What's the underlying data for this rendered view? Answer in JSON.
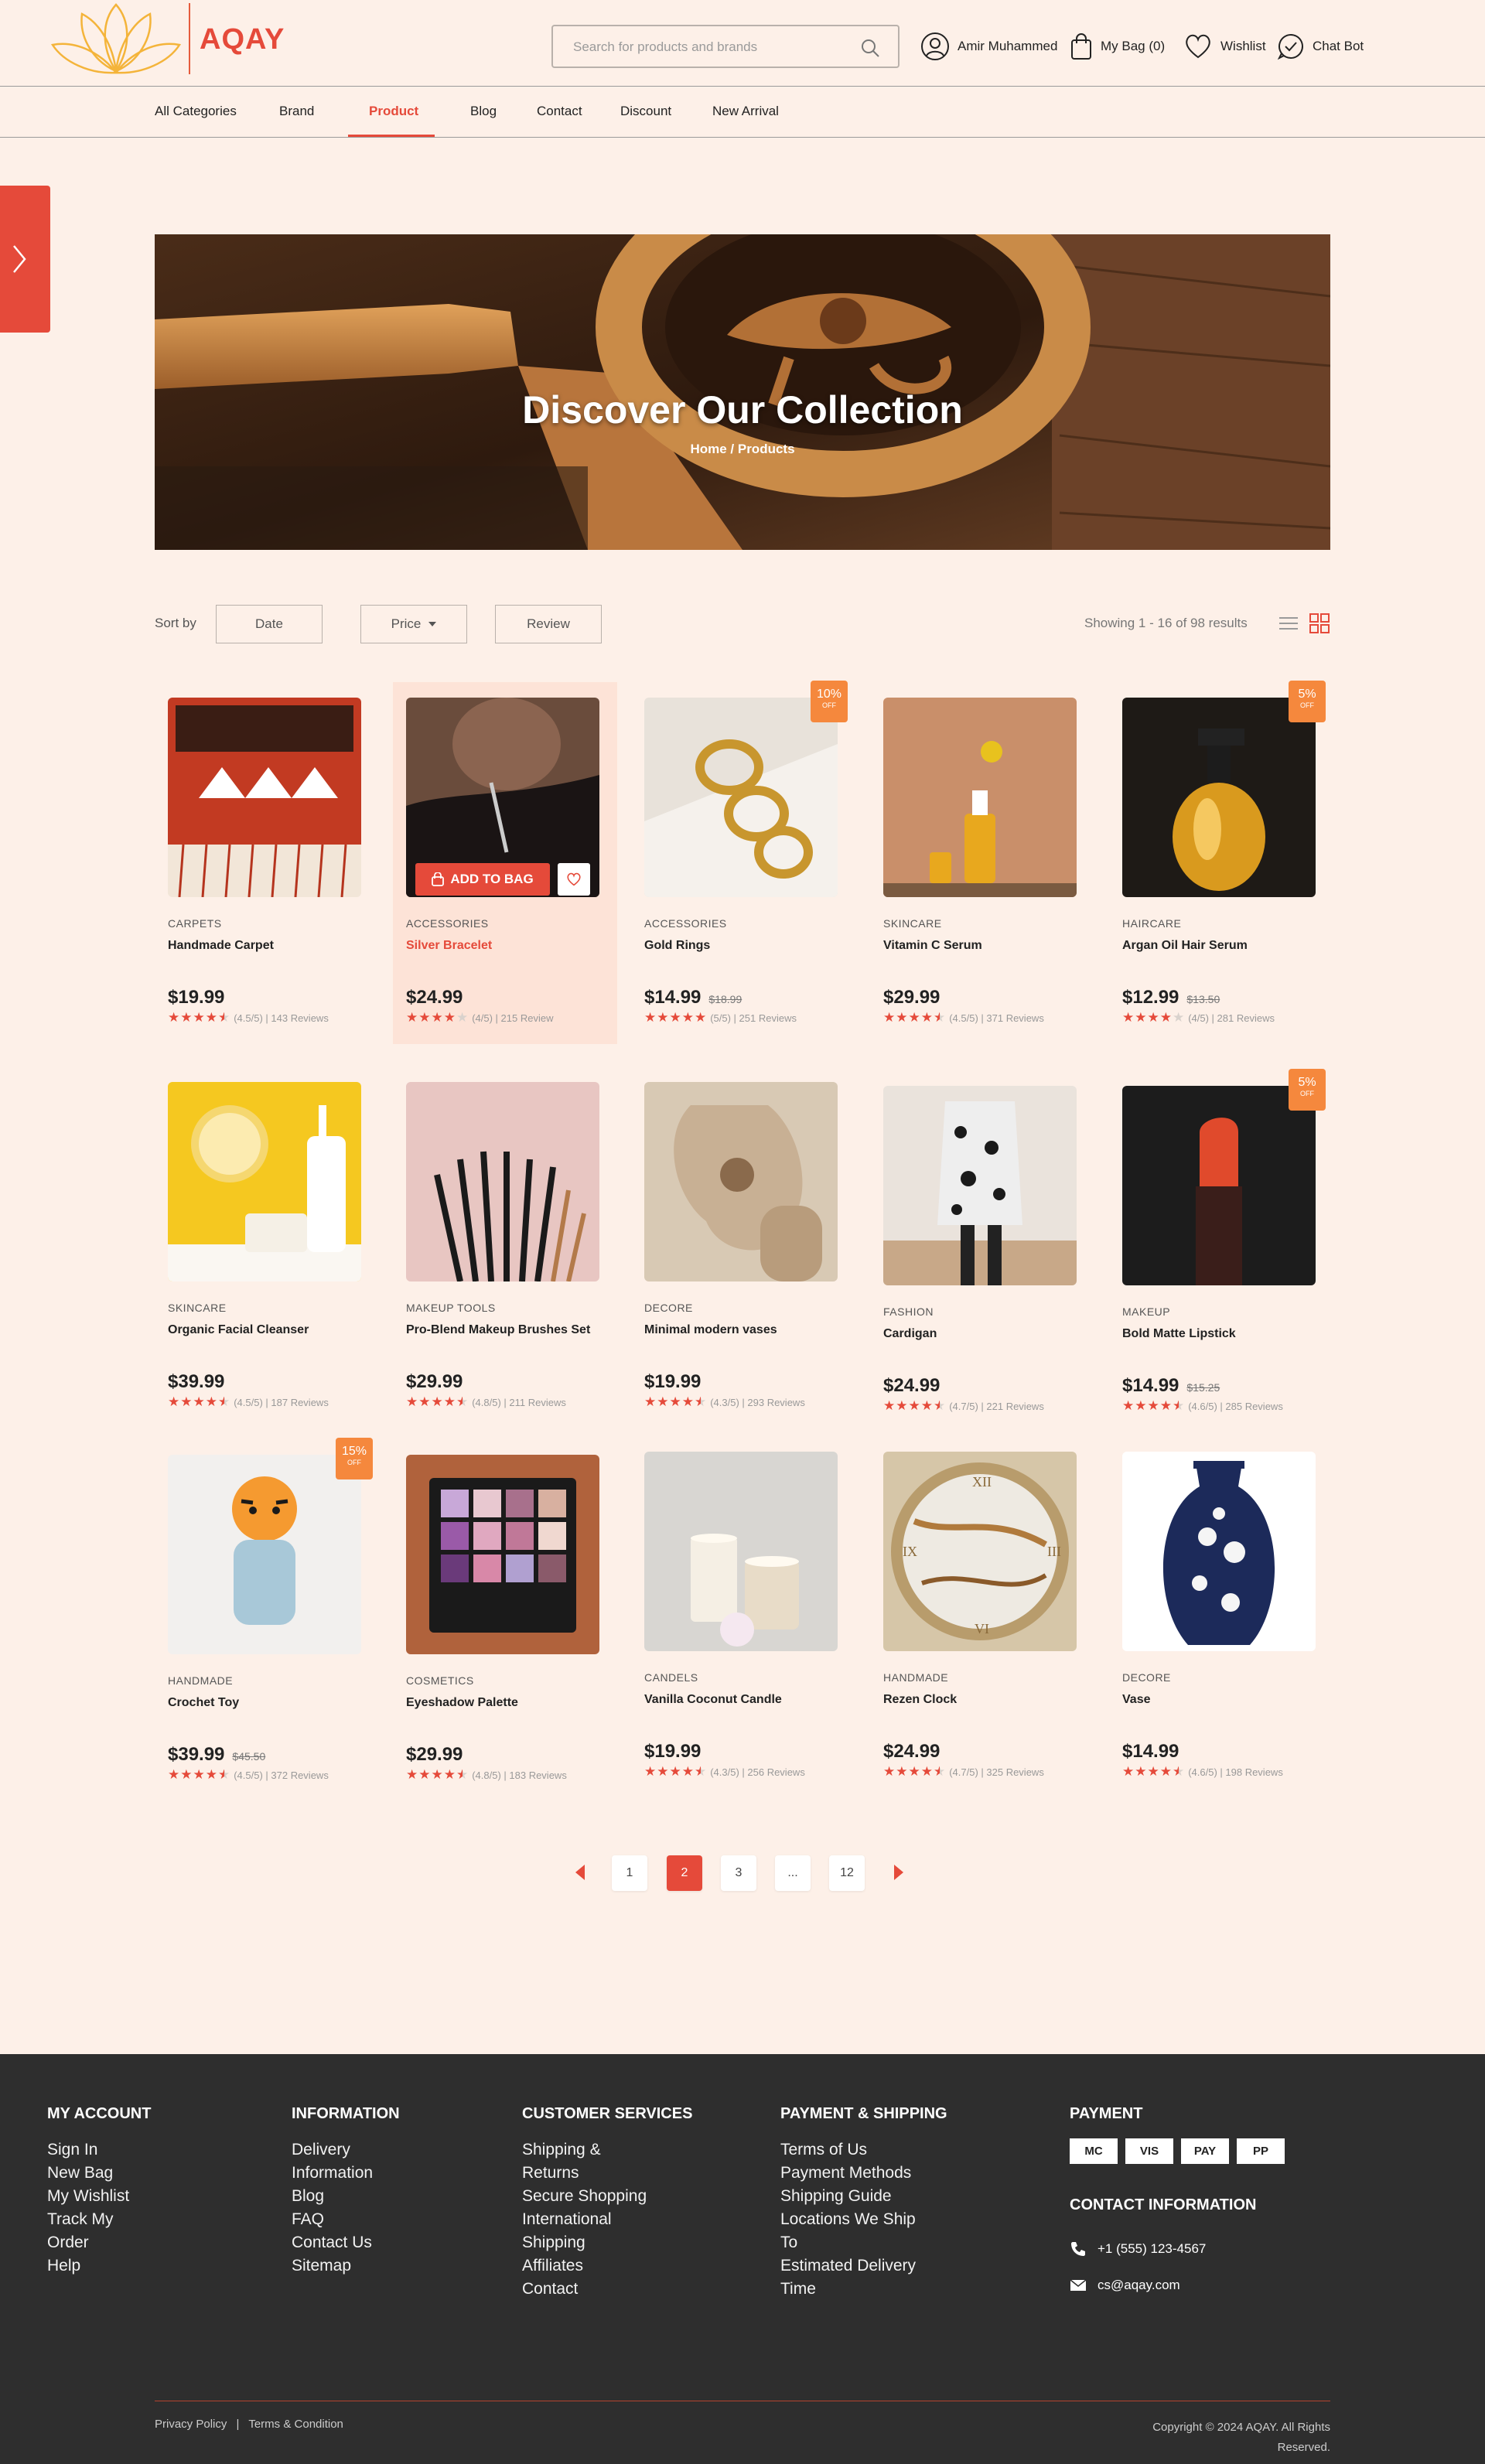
{
  "brand": {
    "name": "AQAY",
    "accent": "#e54a3a",
    "logo_color": "#f4b43a"
  },
  "header": {
    "search_placeholder": "Search for products and brands",
    "user": "Amir Muhammed",
    "bag": "My Bag (0)",
    "wishlist": "Wishlist",
    "chatbot": "Chat Bot"
  },
  "nav": {
    "items": [
      {
        "label": "All Categories"
      },
      {
        "label": "Brand"
      },
      {
        "label": "Product",
        "active": true
      },
      {
        "label": "Blog"
      },
      {
        "label": "Contact"
      },
      {
        "label": "Discount"
      },
      {
        "label": "New Arrival"
      }
    ]
  },
  "hero": {
    "title": "Discover Our Collection",
    "breadcrumb": "Home / Products"
  },
  "toolbar": {
    "sort_label": "Sort by",
    "date": "Date",
    "price": "Price",
    "review": "Review",
    "results": "Showing 1 - 16 of 98 results"
  },
  "products": [
    {
      "category": "CARPETS",
      "name": "Handmade Carpet",
      "price": "$19.99",
      "rating": 4.5,
      "rating_text": "(4.5/5) | 143 Reviews",
      "image": "carpet"
    },
    {
      "category": "ACCESSORIES",
      "name": "Silver Bracelet",
      "price": "$24.99",
      "rating": 4,
      "rating_text": "(4/5) | 215 Review",
      "image": "bracelet",
      "hover": true,
      "add_to_bag": "ADD TO BAG"
    },
    {
      "category": "ACCESSORIES",
      "name": "Gold Rings",
      "price": "$14.99",
      "old_price": "$18.99",
      "badge": "10%",
      "rating": 5,
      "rating_text": "(5/5) | 251 Reviews",
      "image": "rings"
    },
    {
      "category": "SKINCARE",
      "name": "Vitamin C Serum",
      "price": "$29.99",
      "rating": 4.5,
      "rating_text": "(4.5/5) | 371 Reviews",
      "image": "serum"
    },
    {
      "category": "HAIRCARE",
      "name": "Argan Oil Hair Serum",
      "price": "$12.99",
      "old_price": "$13.50",
      "badge": "5%",
      "rating": 4,
      "rating_text": "(4/5) | 281 Reviews",
      "image": "oil"
    },
    {
      "category": "SKINCARE",
      "name": "Organic Facial Cleanser",
      "price": "$39.99",
      "rating": 4.5,
      "rating_text": "(4.5/5) | 187 Reviews",
      "image": "cleanser"
    },
    {
      "category": "MAKEUP TOOLS",
      "name": "Pro-Blend Makeup Brushes Set",
      "price": "$29.99",
      "rating": 4.5,
      "rating_text": "(4.8/5) | 211 Reviews",
      "image": "brushes"
    },
    {
      "category": "DECORE",
      "name": "Minimal modern vases",
      "price": "$19.99",
      "rating": 4.5,
      "rating_text": "(4.3/5) | 293 Reviews",
      "image": "vases"
    },
    {
      "category": "FASHION",
      "name": "Cardigan",
      "price": "$24.99",
      "rating": 4.5,
      "rating_text": "(4.7/5) | 221 Reviews",
      "image": "cardigan"
    },
    {
      "category": "MAKEUP",
      "name": "Bold Matte Lipstick",
      "price": "$14.99",
      "old_price": "$15.25",
      "badge": "5%",
      "rating": 4.5,
      "rating_text": "(4.6/5) | 285 Reviews",
      "image": "lipstick"
    },
    {
      "category": "HANDMADE",
      "name": "Crochet Toy",
      "price": "$39.99",
      "old_price": "$45.50",
      "badge": "15%",
      "rating": 4.5,
      "rating_text": "(4.5/5) | 372 Reviews",
      "image": "toy"
    },
    {
      "category": "COSMETICS",
      "name": "Eyeshadow Palette",
      "price": "$29.99",
      "rating": 4.5,
      "rating_text": "(4.8/5) | 183 Reviews",
      "image": "palette"
    },
    {
      "category": "CANDELS",
      "name": "Vanilla Coconut Candle",
      "price": "$19.99",
      "rating": 4.5,
      "rating_text": "(4.3/5) | 256 Reviews",
      "image": "candle"
    },
    {
      "category": "HANDMADE",
      "name": "Rezen Clock",
      "price": "$24.99",
      "rating": 4.5,
      "rating_text": "(4.7/5) | 325 Reviews",
      "image": "clock"
    },
    {
      "category": "DECORE",
      "name": "Vase",
      "price": "$14.99",
      "rating": 4.5,
      "rating_text": "(4.6/5) | 198 Reviews",
      "image": "vase"
    }
  ],
  "badge_off": "OFF",
  "pagination": {
    "pages": [
      "1",
      "2",
      "3",
      "...",
      "12"
    ],
    "current": "2"
  },
  "footer": {
    "my_account": {
      "title": "MY ACCOUNT",
      "links": [
        "Sign In",
        "New Bag",
        "My Wishlist",
        "Track My",
        "Order",
        "Help"
      ]
    },
    "information": {
      "title": "INFORMATION",
      "links": [
        "Delivery",
        "Information",
        "Blog",
        "FAQ",
        "Contact Us",
        "Sitemap"
      ]
    },
    "customer_services": {
      "title": "CUSTOMER SERVICES",
      "links": [
        "Shipping &",
        "Returns",
        "Secure Shopping",
        "International",
        "Shipping",
        "Affiliates",
        "Contact"
      ]
    },
    "payment_shipping": {
      "title": "PAYMENT & SHIPPING",
      "links": [
        "Terms of Us",
        "Payment Methods",
        "Shipping Guide",
        "Locations We Ship",
        "To",
        "Estimated Delivery",
        "Time"
      ]
    },
    "payment": {
      "title": "PAYMENT",
      "methods": [
        "MC",
        "VIS",
        "PAY",
        "PP"
      ]
    },
    "contact": {
      "title": "CONTACT INFORMATION",
      "phone": "+1 (555) 123-4567",
      "email": "cs@aqay.com"
    },
    "privacy": "Privacy Policy",
    "separator": "|",
    "terms": "Terms & Condition",
    "copyright": "Copyright © 2024 AQAY. All Rights Reserved."
  }
}
